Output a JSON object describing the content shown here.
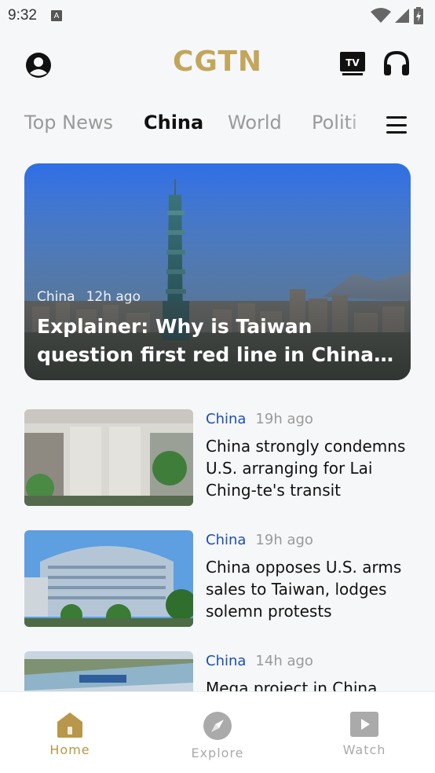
{
  "status_bar": {
    "time": "9:32",
    "notification_letter": "A"
  },
  "header": {
    "logo_text": "CGTN"
  },
  "icons": {
    "tv_label": "TV"
  },
  "tabs": [
    {
      "label": "Top News",
      "active": false
    },
    {
      "label": "China",
      "active": true
    },
    {
      "label": "World",
      "active": false
    },
    {
      "label": "Politi",
      "active": false
    }
  ],
  "hero": {
    "category": "China",
    "time": "12h ago",
    "title": "Explainer: Why is Taiwan question first red line in China-U.S. relations?"
  },
  "articles": [
    {
      "category": "China",
      "time": "19h ago",
      "title": "China strongly condemns U.S. arranging for Lai Ching-te's transit"
    },
    {
      "category": "China",
      "time": "19h ago",
      "title": "China opposes U.S. arms sales to Taiwan, lodges solemn protests"
    },
    {
      "category": "China",
      "time": "14h ago",
      "title": "Mega project in China"
    }
  ],
  "bottom_nav": {
    "items": [
      {
        "label": "Home",
        "active": true
      },
      {
        "label": "Explore",
        "active": false
      },
      {
        "label": "Watch",
        "active": false
      }
    ]
  },
  "colors": {
    "brand_gold": "#c3a65a",
    "category_blue": "#1b4fb5",
    "active_nav": "#b8964a",
    "inactive_gray": "#9a9a9a"
  }
}
